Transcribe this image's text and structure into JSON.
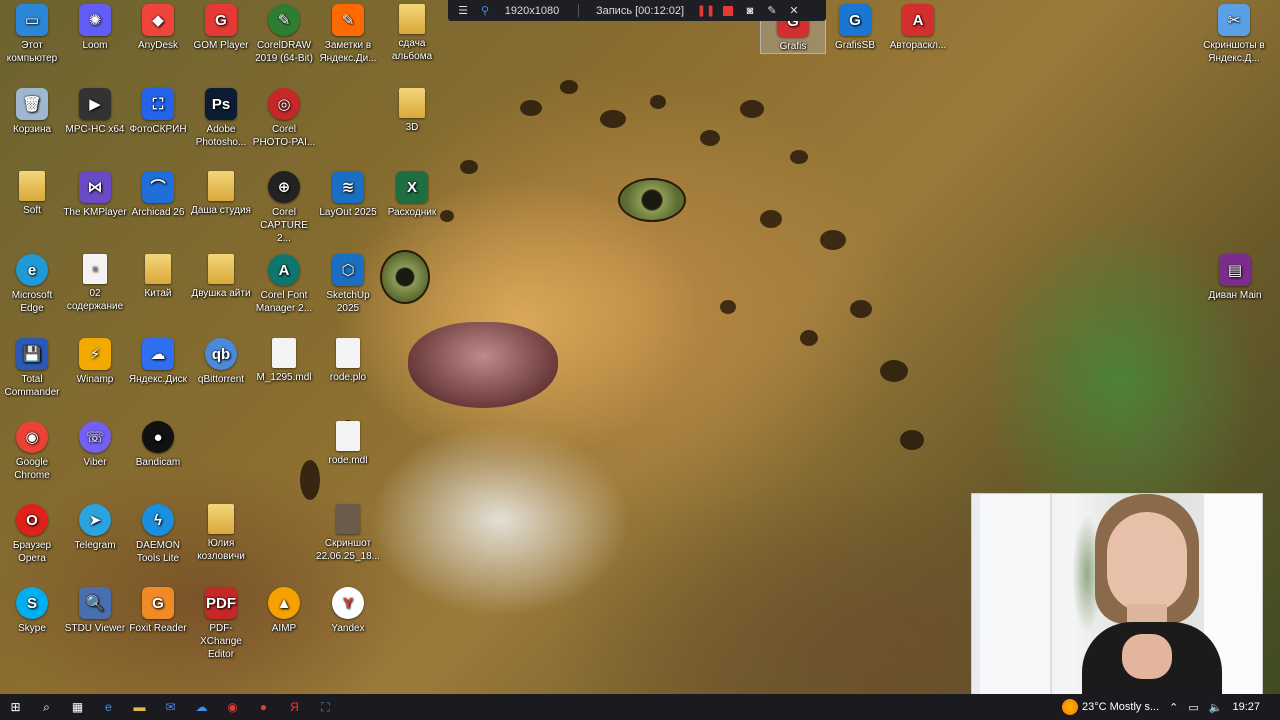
{
  "desktop": {
    "icons_col1": [
      {
        "label": "Этот компьютер",
        "icon": "monitor-icon",
        "color": "#2b88d8",
        "glyph": "▭"
      },
      {
        "label": "Корзина",
        "icon": "recycle-bin-icon",
        "color": "#9fb8cf",
        "glyph": "🗑"
      },
      {
        "label": "Soft",
        "icon": "folder-icon",
        "color": "#e6b84a",
        "glyph": ""
      },
      {
        "label": "Microsoft Edge",
        "icon": "edge-icon",
        "color": "#1f9ad6",
        "glyph": "e"
      },
      {
        "label": "Total Commander",
        "icon": "total-commander-icon",
        "color": "#2a5ab8",
        "glyph": "💾"
      },
      {
        "label": "Google Chrome",
        "icon": "chrome-icon",
        "color": "#ea4335",
        "glyph": "◉"
      },
      {
        "label": "Браузер Opera",
        "icon": "opera-icon",
        "color": "#e0201b",
        "glyph": "O"
      },
      {
        "label": "Skype",
        "icon": "skype-icon",
        "color": "#00aff0",
        "glyph": "S"
      }
    ],
    "icons_col2": [
      {
        "label": "Loom",
        "icon": "loom-icon",
        "color": "#625df5",
        "glyph": "✺"
      },
      {
        "label": "MPC-HC x64",
        "icon": "mpc-hc-icon",
        "color": "#333333",
        "glyph": "▶"
      },
      {
        "label": "The KMPlayer",
        "icon": "kmplayer-icon",
        "color": "#6a4bc4",
        "glyph": "⋈"
      },
      {
        "label": "02 содержание",
        "icon": "document-icon",
        "color": "#eeeeee",
        "glyph": "≡"
      },
      {
        "label": "Winamp",
        "icon": "winamp-icon",
        "color": "#f2a900",
        "glyph": "⚡"
      },
      {
        "label": "Viber",
        "icon": "viber-icon",
        "color": "#7360f2",
        "glyph": "☏"
      },
      {
        "label": "Telegram",
        "icon": "telegram-icon",
        "color": "#2aa3df",
        "glyph": "➤"
      },
      {
        "label": "STDU Viewer",
        "icon": "stdu-viewer-icon",
        "color": "#4a6fb0",
        "glyph": "🔍"
      }
    ],
    "icons_col3": [
      {
        "label": "AnyDesk",
        "icon": "anydesk-icon",
        "color": "#ef443b",
        "glyph": "◆"
      },
      {
        "label": "ФотоСКРИН",
        "icon": "fotoskrin-icon",
        "color": "#2563eb",
        "glyph": "⛶"
      },
      {
        "label": "Archicad 26",
        "icon": "archicad-icon",
        "color": "#1e6fd9",
        "glyph": "⌒"
      },
      {
        "label": "Китай",
        "icon": "folder-icon",
        "color": "#e6b84a",
        "glyph": ""
      },
      {
        "label": "Яндекс.Диск",
        "icon": "yandex-disk-icon",
        "color": "#2f6ef0",
        "glyph": "☁"
      },
      {
        "label": "Bandicam",
        "icon": "bandicam-icon",
        "color": "#111111",
        "glyph": "●"
      },
      {
        "label": "DAEMON Tools Lite",
        "icon": "daemon-tools-icon",
        "color": "#1a8fe0",
        "glyph": "ϟ"
      },
      {
        "label": "Foxit Reader",
        "icon": "foxit-reader-icon",
        "color": "#f08a24",
        "glyph": "G"
      }
    ],
    "icons_col4": [
      {
        "label": "GOM Player",
        "icon": "gom-player-icon",
        "color": "#e53935",
        "glyph": "G"
      },
      {
        "label": "Adobe Photosho...",
        "icon": "photoshop-icon",
        "color": "#0b1c33",
        "glyph": "Ps"
      },
      {
        "label": "Даша студия",
        "icon": "folder-icon",
        "color": "#e6b84a",
        "glyph": ""
      },
      {
        "label": "Двушка айти",
        "icon": "folder-icon",
        "color": "#e6b84a",
        "glyph": ""
      },
      {
        "label": "qBittorrent",
        "icon": "qbittorrent-icon",
        "color": "#4a8ad8",
        "glyph": "qb"
      },
      {
        "label": "Юлия козловичи",
        "icon": "folder-icon",
        "color": "#e6b84a",
        "glyph": ""
      },
      {
        "label": "PDF-XChange Editor",
        "icon": "pdf-xchange-icon",
        "color": "#c62828",
        "glyph": "PDF"
      }
    ],
    "icons_col5": [
      {
        "label": "CorelDRAW 2019 (64-Bit)",
        "icon": "coreldraw-icon",
        "color": "#2e7d32",
        "glyph": "✎"
      },
      {
        "label": "Corel PHOTO-PAI...",
        "icon": "corel-photo-paint-icon",
        "color": "#c62828",
        "glyph": "◎"
      },
      {
        "label": "Corel CAPTURE 2...",
        "icon": "corel-capture-icon",
        "color": "#222222",
        "glyph": "⊕"
      },
      {
        "label": "Corel Font Manager 2...",
        "icon": "corel-font-manager-icon",
        "color": "#0f766e",
        "glyph": "A"
      },
      {
        "label": "M_1295.mdl",
        "icon": "file-icon",
        "color": "#f3f3f3",
        "glyph": ""
      },
      {
        "label": "AIMP",
        "icon": "aimp-icon",
        "color": "#f5a100",
        "glyph": "▲"
      }
    ],
    "icons_col6": [
      {
        "label": "Заметки в Яндекс.Ди...",
        "icon": "notes-icon",
        "color": "#ff6a00",
        "glyph": "✎"
      },
      {
        "label": "LayOut 2025",
        "icon": "layout-icon",
        "color": "#1b6fc2",
        "glyph": "≋"
      },
      {
        "label": "SketchUp 2025",
        "icon": "sketchup-icon",
        "color": "#1b6fc2",
        "glyph": "⬡"
      },
      {
        "label": "rode.plo",
        "icon": "file-icon",
        "color": "#f3f3f3",
        "glyph": ""
      },
      {
        "label": "rode.mdl",
        "icon": "file-icon",
        "color": "#f3f3f3",
        "glyph": ""
      },
      {
        "label": "Скриншот 22.06.25_18...",
        "icon": "screenshot-file-icon",
        "color": "#6b5b4b",
        "glyph": ""
      },
      {
        "label": "Yandex",
        "icon": "yandex-browser-icon",
        "color": "#ffffff",
        "glyph": "Y"
      }
    ],
    "icons_col7": [
      {
        "label": "сдача альбома",
        "icon": "folder-icon",
        "color": "#e6b84a",
        "glyph": ""
      },
      {
        "label": "3D",
        "icon": "folder-icon",
        "color": "#e6b84a",
        "glyph": ""
      },
      {
        "label": "Расходник",
        "icon": "excel-icon",
        "color": "#1d6f42",
        "glyph": "X"
      }
    ],
    "icons_top_right": [
      {
        "label": "Grafis",
        "icon": "grafis-icon",
        "color": "#d32f2f",
        "glyph": "G"
      },
      {
        "label": "GrafisSB",
        "icon": "grafissb-icon",
        "color": "#1976d2",
        "glyph": "G"
      },
      {
        "label": "Автораскл...",
        "icon": "avtoraskladka-icon",
        "color": "#d32f2f",
        "glyph": "A"
      }
    ],
    "icons_right": [
      {
        "label": "Скриншоты в Яндекс.Д...",
        "icon": "screenshots-icon",
        "color": "#5aa0e6",
        "glyph": "✂"
      },
      {
        "label": "Диван Main",
        "icon": "winrar-icon",
        "color": "#7b2d8b",
        "glyph": "▤"
      }
    ]
  },
  "recorder": {
    "resolution": "1920x1080",
    "status": "Запись [00:12:02]",
    "accent": "#e53935"
  },
  "taskbar": {
    "buttons": [
      {
        "name": "start-button",
        "icon": "windows-icon",
        "glyph": "⊞"
      },
      {
        "name": "search-button",
        "icon": "search-icon",
        "glyph": "⌕"
      },
      {
        "name": "task-view-button",
        "icon": "task-view-icon",
        "glyph": "▦"
      },
      {
        "name": "edge-taskbar-button",
        "icon": "edge-icon",
        "glyph": "e"
      },
      {
        "name": "explorer-taskbar-button",
        "icon": "folder-icon",
        "glyph": "▬"
      },
      {
        "name": "mail-taskbar-button",
        "icon": "mail-icon",
        "glyph": "✉"
      },
      {
        "name": "yandex-disk-taskbar-button",
        "icon": "yandex-disk-icon",
        "glyph": "☁"
      },
      {
        "name": "bandicam-taskbar-button",
        "icon": "bandicam-icon",
        "glyph": "◉"
      },
      {
        "name": "record-taskbar-button",
        "icon": "record-icon",
        "glyph": "●"
      },
      {
        "name": "yandex-taskbar-button",
        "icon": "yandex-icon",
        "glyph": "Я"
      },
      {
        "name": "fotoskrin-taskbar-button",
        "icon": "fotoskrin-icon",
        "glyph": "⛶"
      }
    ],
    "weather_text": "23°C Mostly s...",
    "clock": "19:27"
  }
}
